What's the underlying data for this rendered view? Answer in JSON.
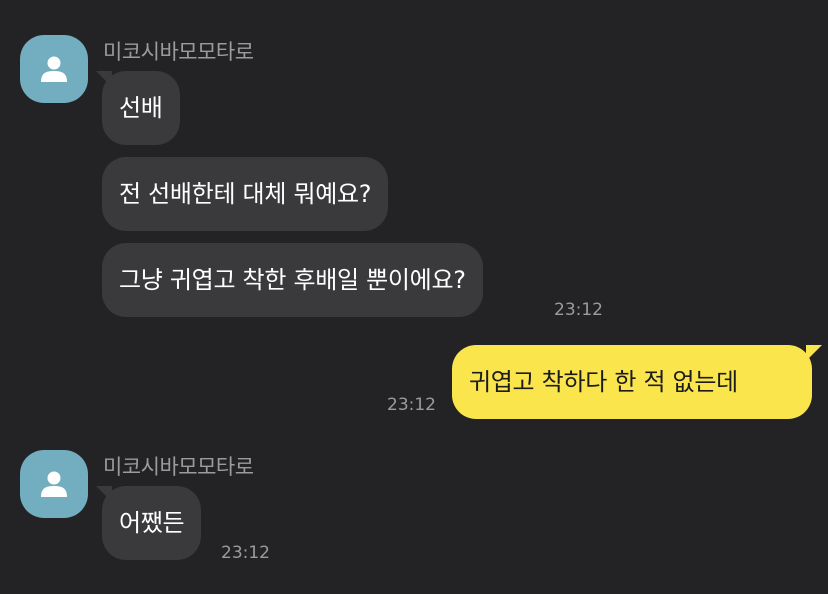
{
  "colors": {
    "background": "#232325",
    "incoming_bubble": "#3a3a3d",
    "outgoing_bubble": "#fae54c",
    "avatar": "#72aec0",
    "meta_text": "#9b9b9f"
  },
  "icons": {
    "avatar": "person-icon"
  },
  "groups": [
    {
      "sender": "미코시바모모타로",
      "messages": [
        "선배",
        "전 선배한테 대체 뭐예요?",
        "그냥 귀엽고 착한 후배일 뿐이에요?"
      ],
      "time": "23:12"
    },
    {
      "mine": true,
      "messages": [
        "귀엽고 착하다 한 적 없는데"
      ],
      "time": "23:12"
    },
    {
      "sender": "미코시바모모타로",
      "messages": [
        "어쨌든"
      ],
      "time": "23:12"
    }
  ]
}
